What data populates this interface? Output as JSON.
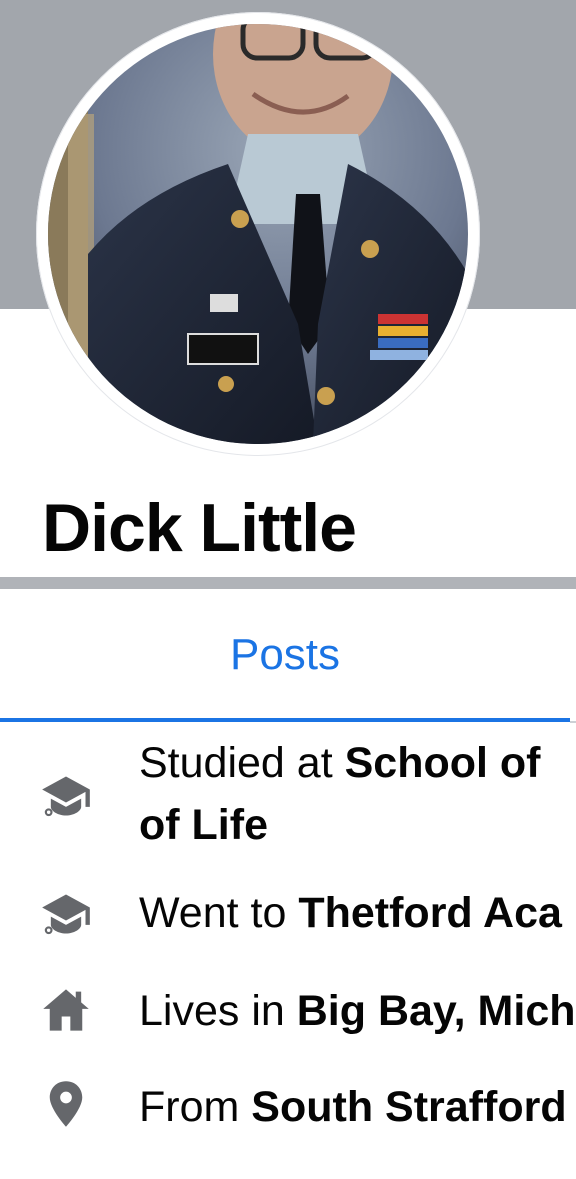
{
  "profile": {
    "name": "Dick Little"
  },
  "tabs": {
    "posts_label": "Posts"
  },
  "intro": [
    {
      "icon": "graduation-cap-icon",
      "prefix": "Studied at ",
      "value_line1": "School of",
      "value_line2": "of Life"
    },
    {
      "icon": "graduation-cap-icon",
      "prefix": "Went to ",
      "value": "Thetford Aca"
    },
    {
      "icon": "home-icon",
      "prefix": "Lives in ",
      "value": "Big Bay, Mich"
    },
    {
      "icon": "location-pin-icon",
      "prefix": "From ",
      "value": "South Strafford"
    }
  ],
  "colors": {
    "cover": "#a2a6ac",
    "accent": "#1b74e4",
    "icon": "#65676b",
    "text": "#050505"
  }
}
